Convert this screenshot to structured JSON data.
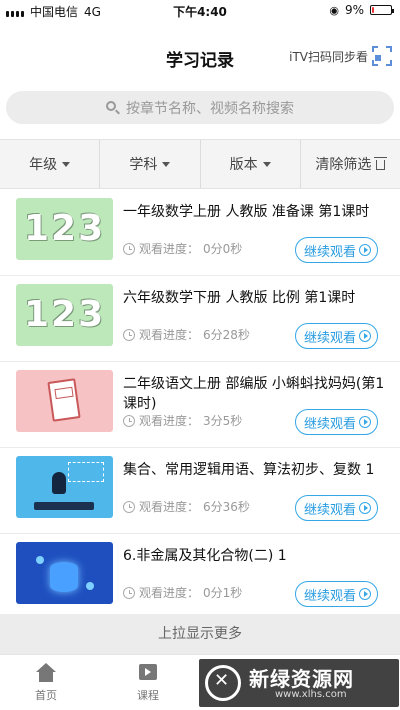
{
  "status_bar": {
    "carrier": "中国电信",
    "network": "4G",
    "time": "下午4:40",
    "battery": "9%",
    "battery_level": 0.09
  },
  "nav": {
    "title": "学习记录",
    "scan_label": "iTV扫码同步看",
    "accent": "#5b8fd9"
  },
  "search": {
    "placeholder": "按章节名称、视频名称搜索"
  },
  "filters": {
    "grade": "年级",
    "subject": "学科",
    "edition": "版本",
    "clear": "清除筛选"
  },
  "records": [
    {
      "title": "一年级数学上册 人教版 准备课 第1课时",
      "progress_label": "观看进度：",
      "progress": "0分0秒",
      "button": "继续观看",
      "thumb_text": "123"
    },
    {
      "title": "六年级数学下册 人教版 比例 第1课时",
      "progress_label": "观看进度：",
      "progress": "6分28秒",
      "button": "继续观看",
      "thumb_text": "123"
    },
    {
      "title": "二年级语文上册 部编版 小蝌蚪找妈妈(第1课时)",
      "progress_label": "观看进度：",
      "progress": "3分5秒",
      "button": "继续观看"
    },
    {
      "title": "集合、常用逻辑用语、算法初步、复数 1",
      "progress_label": "观看进度：",
      "progress": "6分36秒",
      "button": "继续观看"
    },
    {
      "title": "6.非金属及其化合物(二) 1",
      "progress_label": "观看进度：",
      "progress": "0分1秒",
      "button": "继续观看"
    }
  ],
  "load_more": "上拉显示更多",
  "tabs": {
    "home": "首页",
    "course": "课程"
  },
  "watermark": {
    "name": "新绿资源网",
    "url": "www.xlhs.com"
  },
  "colors": {
    "button_blue": "#2a9de0",
    "battery_low": "#e33"
  }
}
